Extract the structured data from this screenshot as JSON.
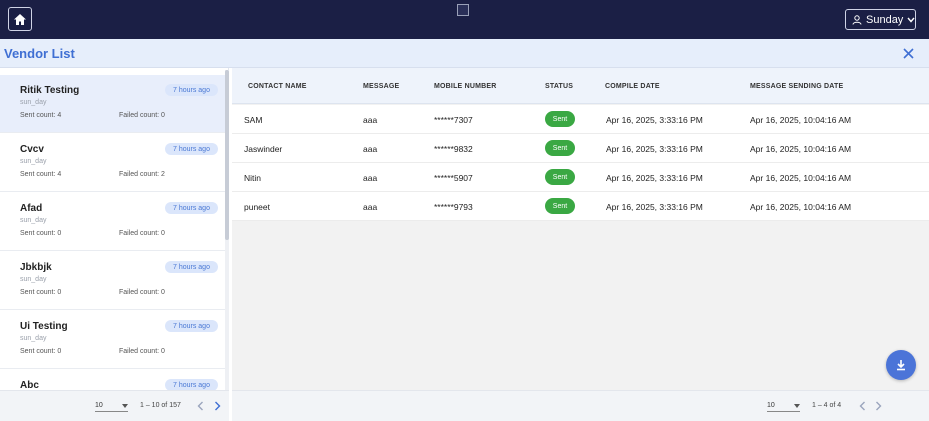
{
  "navbar": {
    "home_icon": "home-icon",
    "user_label": "Sunday",
    "user_icon": "user-icon",
    "dropdown_icon": "chevron-down-icon",
    "bg_color": "#1b1f45"
  },
  "title_bar": {
    "title": "Vendor List",
    "close_icon": "close-icon",
    "accent_color": "#3f6fd3"
  },
  "vendors": [
    {
      "name": "Ritik Testing",
      "sub": "sun_day",
      "time": "7 hours ago",
      "sent": "Sent count: 4",
      "failed": "Failed count: 0",
      "selected": true
    },
    {
      "name": "Cvcv",
      "sub": "sun_day",
      "time": "7 hours ago",
      "sent": "Sent count: 4",
      "failed": "Failed count: 2",
      "selected": false
    },
    {
      "name": "Afad",
      "sub": "sun_day",
      "time": "7 hours ago",
      "sent": "Sent count: 0",
      "failed": "Failed count: 0",
      "selected": false
    },
    {
      "name": "Jbkbjk",
      "sub": "sun_day",
      "time": "7 hours ago",
      "sent": "Sent count: 0",
      "failed": "Failed count: 0",
      "selected": false
    },
    {
      "name": "Ui Testing",
      "sub": "sun_day",
      "time": "7 hours ago",
      "sent": "Sent count: 0",
      "failed": "Failed count: 0",
      "selected": false
    },
    {
      "name": "Abc",
      "sub": "",
      "time": "7 hours ago",
      "sent": "",
      "failed": "",
      "selected": false
    }
  ],
  "left_pager": {
    "page_size": "10",
    "range": "1 – 10 of 157",
    "prev_icon": "chevron-left-icon",
    "next_icon": "chevron-right-icon"
  },
  "table": {
    "columns": [
      "CONTACT NAME",
      "MESSAGE",
      "MOBILE NUMBER",
      "STATUS",
      "COMPILE DATE",
      "MESSAGE SENDING DATE"
    ],
    "rows": [
      {
        "contact": "SAM",
        "message": "aaa",
        "mobile": "******7307",
        "status": "Sent",
        "compile": "Apr 16, 2025, 3:33:16 PM",
        "sending": "Apr 16, 2025, 10:04:16 AM"
      },
      {
        "contact": "Jaswinder",
        "message": "aaa",
        "mobile": "******9832",
        "status": "Sent",
        "compile": "Apr 16, 2025, 3:33:16 PM",
        "sending": "Apr 16, 2025, 10:04:16 AM"
      },
      {
        "contact": "Nitin",
        "message": "aaa",
        "mobile": "******5907",
        "status": "Sent",
        "compile": "Apr 16, 2025, 3:33:16 PM",
        "sending": "Apr 16, 2025, 10:04:16 AM"
      },
      {
        "contact": "puneet",
        "message": "aaa",
        "mobile": "******9793",
        "status": "Sent",
        "compile": "Apr 16, 2025, 3:33:16 PM",
        "sending": "Apr 16, 2025, 10:04:16 AM"
      }
    ],
    "status_color": "#3aa843"
  },
  "download_icon": "download-icon",
  "right_pager": {
    "page_size": "10",
    "range": "1 – 4 of 4",
    "prev_icon": "chevron-left-icon",
    "next_icon": "chevron-right-icon"
  }
}
